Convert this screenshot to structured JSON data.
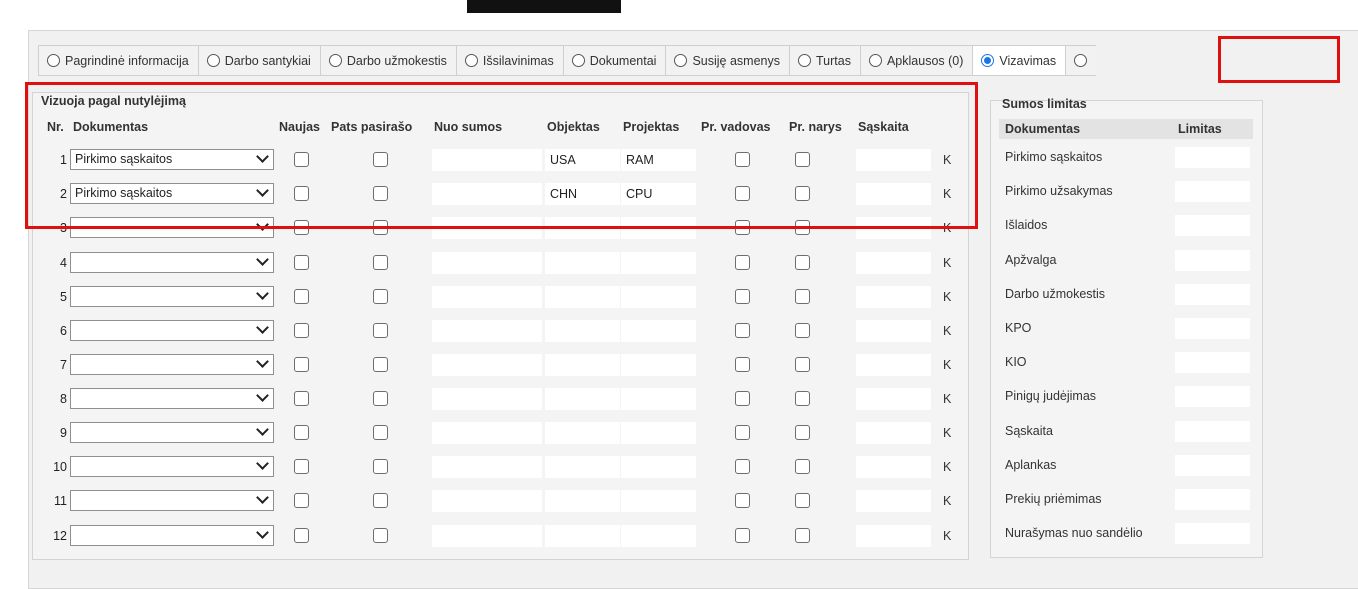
{
  "tabs": [
    {
      "label": "Pagrindinė informacija",
      "active": false
    },
    {
      "label": "Darbo santykiai",
      "active": false
    },
    {
      "label": "Darbo užmokestis",
      "active": false
    },
    {
      "label": "Išsilavinimas",
      "active": false
    },
    {
      "label": "Dokumentai",
      "active": false
    },
    {
      "label": "Susiję asmenys",
      "active": false
    },
    {
      "label": "Turtas",
      "active": false
    },
    {
      "label": "Apklausos (0)",
      "active": false
    },
    {
      "label": "Vizavimas",
      "active": true
    }
  ],
  "main": {
    "title": "Vizuoja pagal nutylėjimą",
    "headers": {
      "nr": "Nr.",
      "dokumentas": "Dokumentas",
      "naujas": "Naujas",
      "pats": "Pats pasirašo",
      "nuo": "Nuo sumos",
      "objektas": "Objektas",
      "projektas": "Projektas",
      "vadovas": "Pr. vadovas",
      "narys": "Pr. narys",
      "saskaita": "Sąskaita"
    },
    "rows": [
      {
        "nr": "1",
        "dokumentas": "Pirkimo sąskaitos",
        "objektas": "USA",
        "projektas": "RAM",
        "k": "K"
      },
      {
        "nr": "2",
        "dokumentas": "Pirkimo sąskaitos",
        "objektas": "CHN",
        "projektas": "CPU",
        "k": "K"
      },
      {
        "nr": "3",
        "dokumentas": "",
        "objektas": "",
        "projektas": "",
        "k": "K"
      },
      {
        "nr": "4",
        "dokumentas": "",
        "objektas": "",
        "projektas": "",
        "k": "K"
      },
      {
        "nr": "5",
        "dokumentas": "",
        "objektas": "",
        "projektas": "",
        "k": "K"
      },
      {
        "nr": "6",
        "dokumentas": "",
        "objektas": "",
        "projektas": "",
        "k": "K"
      },
      {
        "nr": "7",
        "dokumentas": "",
        "objektas": "",
        "projektas": "",
        "k": "K"
      },
      {
        "nr": "8",
        "dokumentas": "",
        "objektas": "",
        "projektas": "",
        "k": "K"
      },
      {
        "nr": "9",
        "dokumentas": "",
        "objektas": "",
        "projektas": "",
        "k": "K"
      },
      {
        "nr": "10",
        "dokumentas": "",
        "objektas": "",
        "projektas": "",
        "k": "K"
      },
      {
        "nr": "11",
        "dokumentas": "",
        "objektas": "",
        "projektas": "",
        "k": "K"
      },
      {
        "nr": "12",
        "dokumentas": "",
        "objektas": "",
        "projektas": "",
        "k": "K"
      }
    ]
  },
  "limits": {
    "title": "Sumos limitas",
    "headers": {
      "dokumentas": "Dokumentas",
      "limitas": "Limitas"
    },
    "rows": [
      {
        "label": "Pirkimo sąskaitos"
      },
      {
        "label": "Pirkimo užsakymas"
      },
      {
        "label": "Išlaidos"
      },
      {
        "label": "Apžvalga"
      },
      {
        "label": "Darbo užmokestis"
      },
      {
        "label": "KPO"
      },
      {
        "label": "KIO"
      },
      {
        "label": "Pinigų judėjimas"
      },
      {
        "label": "Sąskaita"
      },
      {
        "label": "Aplankas"
      },
      {
        "label": "Prekių priėmimas"
      },
      {
        "label": "Nurašymas nuo sandėlio"
      }
    ]
  },
  "colors": {
    "highlight": "#e01010",
    "radio_active": "#1a73e8"
  }
}
